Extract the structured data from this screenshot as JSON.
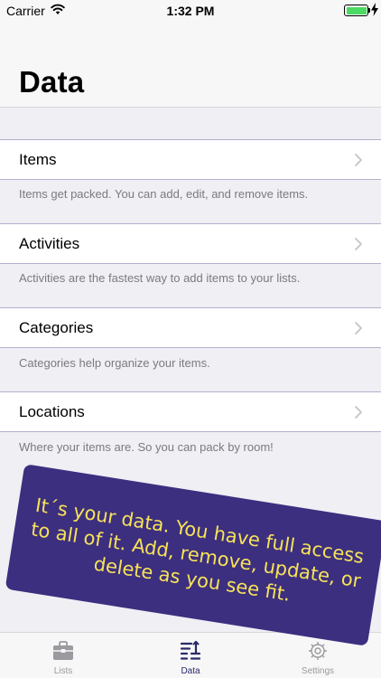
{
  "status_bar": {
    "carrier": "Carrier",
    "time": "1:32 PM"
  },
  "header": {
    "title": "Data"
  },
  "rows": [
    {
      "label": "Items",
      "footer": "Items get packed. You can add, edit, and remove items."
    },
    {
      "label": "Activities",
      "footer": "Activities are the fastest way to add items to your lists."
    },
    {
      "label": "Categories",
      "footer": "Categories help organize your items."
    },
    {
      "label": "Locations",
      "footer": "Where your items are. So you can pack by room!"
    }
  ],
  "banner": {
    "text": "It´s your data. You have full access to all of it. Add, remove, update, or delete as you see fit."
  },
  "tab_bar": {
    "tabs": [
      {
        "label": "Lists",
        "icon": "suitcase-icon"
      },
      {
        "label": "Data",
        "icon": "sort-list-icon"
      },
      {
        "label": "Settings",
        "icon": "gear-icon"
      }
    ],
    "active_index": 1
  },
  "colors": {
    "accent": "#2a2a6a",
    "banner_bg": "#3c2f7f",
    "banner_text": "#f7e25a",
    "battery": "#4cd964"
  }
}
